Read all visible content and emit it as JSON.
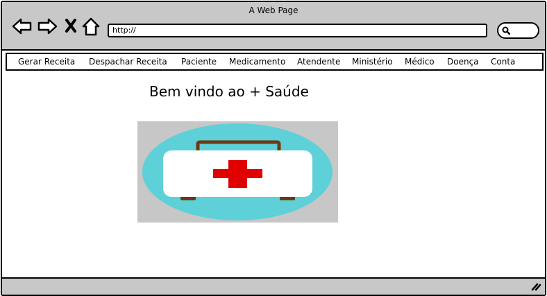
{
  "window": {
    "title": "A Web Page"
  },
  "address_bar": {
    "url": "http://"
  },
  "nav_icons": [
    "back-arrow-icon",
    "forward-arrow-icon",
    "close-x-icon",
    "home-icon",
    "search-icon"
  ],
  "menu": {
    "items": [
      {
        "label": "Gerar Receita"
      },
      {
        "label": "Despachar Receita"
      },
      {
        "label": "Paciente"
      },
      {
        "label": "Medicamento"
      },
      {
        "label": "Atendente"
      },
      {
        "label": "Ministério"
      },
      {
        "label": "Médico"
      },
      {
        "label": "Doença"
      },
      {
        "label": "Conta"
      }
    ]
  },
  "main": {
    "welcome_text": "Bem vindo ao + Saúde"
  },
  "colors": {
    "chrome": "#c8c8c8",
    "ellipse": "#5dd0d8",
    "kit_body": "#ffffff",
    "kit_handle": "#6b3a12",
    "cross": "#e00000"
  }
}
